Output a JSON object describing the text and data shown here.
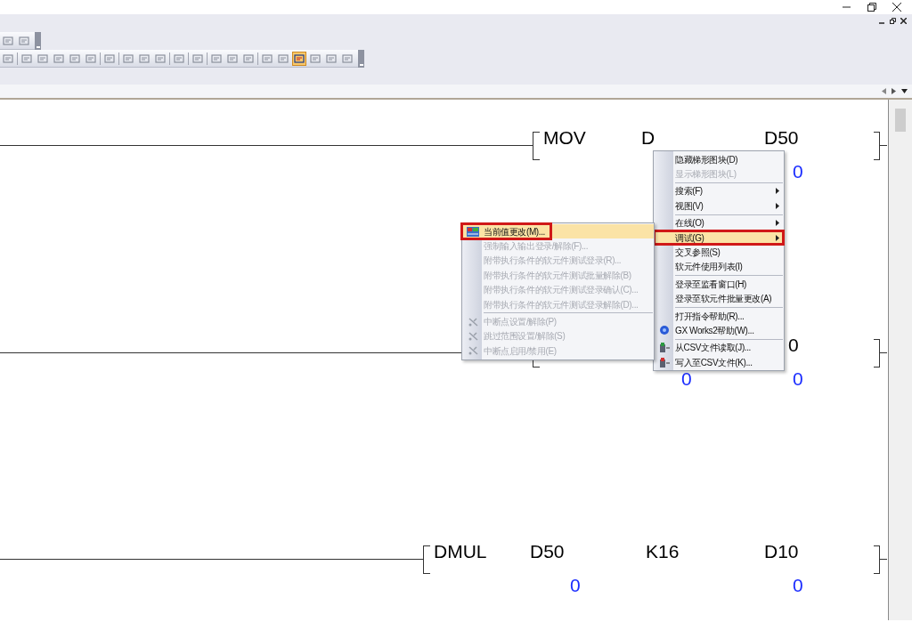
{
  "toolbars": [
    {
      "buttons": [
        {
          "selected": false
        },
        {
          "selected": false
        }
      ]
    },
    {
      "buttons": [
        {
          "selected": false
        },
        {
          "kind": "separator"
        },
        {
          "selected": false
        },
        {
          "selected": false
        },
        {
          "selected": false
        },
        {
          "selected": false
        },
        {
          "selected": false
        },
        {
          "kind": "separator"
        },
        {
          "selected": false
        },
        {
          "kind": "separator"
        },
        {
          "selected": false
        },
        {
          "selected": false
        },
        {
          "selected": false
        },
        {
          "kind": "separator"
        },
        {
          "selected": false
        },
        {
          "kind": "separator"
        },
        {
          "selected": false
        },
        {
          "kind": "separator"
        },
        {
          "selected": false
        },
        {
          "selected": false
        },
        {
          "selected": false
        },
        {
          "kind": "separator"
        },
        {
          "selected": false
        },
        {
          "selected": false
        },
        {
          "selected": true
        },
        {
          "selected": false
        },
        {
          "selected": false
        },
        {
          "selected": false
        }
      ]
    }
  ],
  "rungs": [
    {
      "instruction": "MOV",
      "operands": [
        {
          "label": "D"
        },
        {
          "label": "D50",
          "value": "0"
        }
      ]
    },
    {
      "operands": [
        {
          "value": "0"
        },
        {
          "label": "0",
          "value": "0"
        }
      ]
    },
    {
      "instruction": "DMUL",
      "operands": [
        {
          "label": "D50",
          "value": "0"
        },
        {
          "label": "K16"
        },
        {
          "label": "D10",
          "value": "0"
        }
      ]
    }
  ],
  "context_menu": {
    "items": [
      {
        "kind": "item",
        "label": "隐藏梯形图块(D)",
        "disabled": false,
        "selected": false,
        "submenu": false
      },
      {
        "kind": "item",
        "label": "显示梯形图块(L)",
        "disabled": true,
        "selected": false,
        "submenu": false
      },
      {
        "kind": "separator"
      },
      {
        "kind": "item",
        "label": "搜索(F)",
        "disabled": false,
        "selected": false,
        "submenu": true
      },
      {
        "kind": "item",
        "label": "视图(V)",
        "disabled": false,
        "selected": false,
        "submenu": true
      },
      {
        "kind": "separator"
      },
      {
        "kind": "item",
        "label": "在线(O)",
        "disabled": false,
        "selected": false,
        "submenu": true
      },
      {
        "kind": "item",
        "label": "调试(G)",
        "disabled": false,
        "selected": true,
        "submenu": true,
        "annotated": true
      },
      {
        "kind": "item",
        "label": "交叉参照(S)",
        "disabled": false,
        "selected": false,
        "submenu": false
      },
      {
        "kind": "item",
        "label": "软元件使用列表(I)",
        "disabled": false,
        "selected": false,
        "submenu": false
      },
      {
        "kind": "separator"
      },
      {
        "kind": "item",
        "label": "登录至监看窗口(H)",
        "disabled": false,
        "selected": false,
        "submenu": false
      },
      {
        "kind": "item",
        "label": "登录至软元件批量更改(A)",
        "disabled": false,
        "selected": false,
        "submenu": false
      },
      {
        "kind": "separator"
      },
      {
        "kind": "item",
        "label": "打开指令帮助(R)...",
        "disabled": false,
        "selected": false,
        "submenu": false
      },
      {
        "kind": "item",
        "label": "GX Works2帮助(W)...",
        "disabled": false,
        "selected": false,
        "submenu": false,
        "icon": true
      },
      {
        "kind": "separator"
      },
      {
        "kind": "item",
        "label": "从CSV文件读取(J)...",
        "disabled": false,
        "selected": false,
        "submenu": false,
        "icon": true
      },
      {
        "kind": "item",
        "label": "写入至CSV文件(K)...",
        "disabled": false,
        "selected": false,
        "submenu": false,
        "icon": true
      }
    ]
  },
  "submenu": {
    "items": [
      {
        "kind": "item",
        "label": "当前值更改(M)...",
        "disabled": false,
        "selected": true,
        "icon": true,
        "annotated": true
      },
      {
        "kind": "item",
        "label": "强制输入输出登录/解除(F)...",
        "disabled": true,
        "selected": false
      },
      {
        "kind": "item",
        "label": "附带执行条件的软元件测试登录(R)...",
        "disabled": true,
        "selected": false
      },
      {
        "kind": "item",
        "label": "附带执行条件的软元件测试批量解除(B)",
        "disabled": true,
        "selected": false
      },
      {
        "kind": "item",
        "label": "附带执行条件的软元件测试登录确认(C)...",
        "disabled": true,
        "selected": false
      },
      {
        "kind": "item",
        "label": "附带执行条件的软元件测试登录解除(D)...",
        "disabled": true,
        "selected": false
      },
      {
        "kind": "separator"
      },
      {
        "kind": "item",
        "label": "中断点设置/解除(P)",
        "disabled": true,
        "selected": false,
        "icon": true
      },
      {
        "kind": "item",
        "label": "跳过范围设置/解除(S)",
        "disabled": true,
        "selected": false,
        "icon": true
      },
      {
        "kind": "item",
        "label": "中断点启用/禁用(E)",
        "disabled": true,
        "selected": false,
        "icon": true
      }
    ]
  }
}
